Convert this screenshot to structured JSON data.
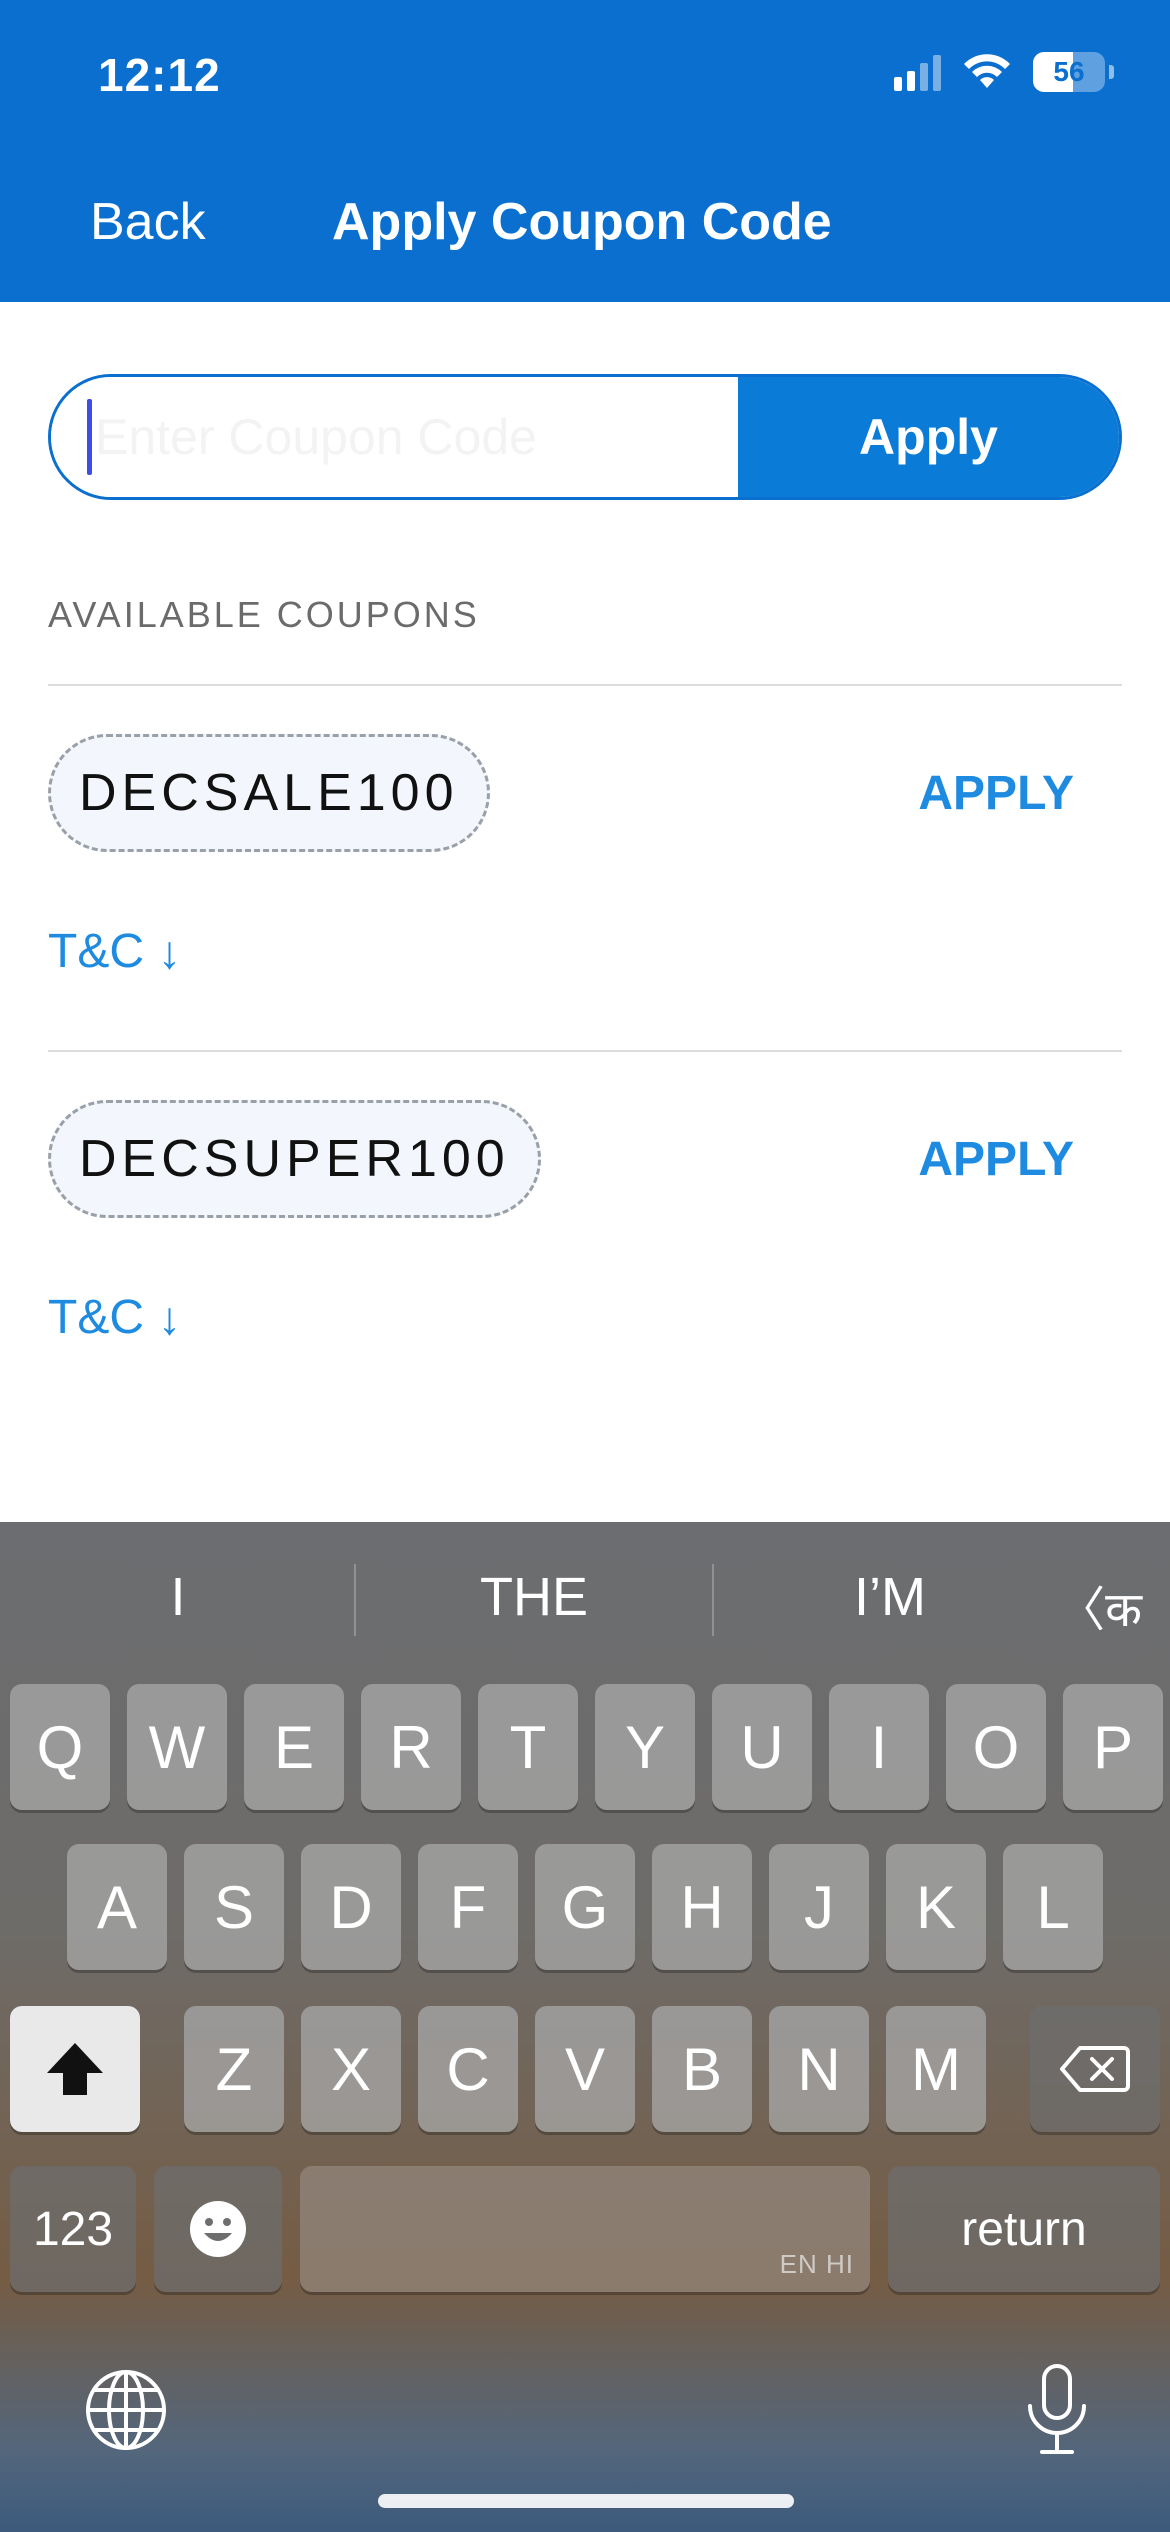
{
  "status_bar": {
    "time": "12:12",
    "battery": "56",
    "battery_level": 0.56,
    "signal_icon": "cellular-signal-icon",
    "wifi_icon": "wifi-icon"
  },
  "header": {
    "back_label": "Back",
    "title": "Apply Coupon Code"
  },
  "coupon_input": {
    "placeholder": "Enter Coupon Code",
    "value": "",
    "apply_label": "Apply"
  },
  "available": {
    "section_label": "AVAILABLE COUPONS",
    "coupons": [
      {
        "code": "DECSALE100",
        "apply_label": "APPLY",
        "tc_label": "T&C",
        "tc_arrow": "↓"
      },
      {
        "code": "DECSUPER100",
        "apply_label": "APPLY",
        "tc_label": "T&C",
        "tc_arrow": "↓"
      }
    ]
  },
  "keyboard": {
    "suggestions": [
      "I",
      "THE",
      "I’M"
    ],
    "language_toggle": "〈क",
    "row1": [
      "Q",
      "W",
      "E",
      "R",
      "T",
      "Y",
      "U",
      "I",
      "O",
      "P"
    ],
    "row2": [
      "A",
      "S",
      "D",
      "F",
      "G",
      "H",
      "J",
      "K",
      "L"
    ],
    "row3": [
      "Z",
      "X",
      "C",
      "V",
      "B",
      "N",
      "M"
    ],
    "numbers_label": "123",
    "space_lang_label": "EN HI",
    "return_label": "return",
    "shift_icon": "shift-icon",
    "delete_icon": "delete-icon",
    "emoji_icon": "emoji-icon",
    "globe_icon": "globe-icon",
    "mic_icon": "microphone-icon"
  },
  "colors": {
    "brand": "#0a6fcf",
    "accent": "#1e8be0"
  }
}
